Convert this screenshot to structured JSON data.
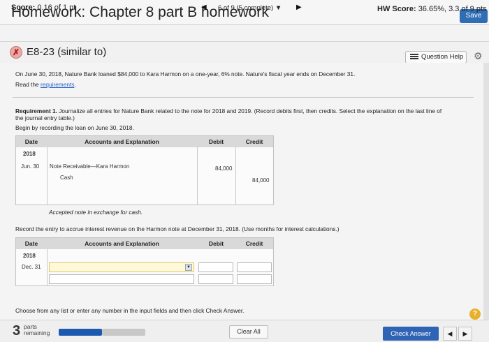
{
  "header": {
    "title": "Homework: Chapter 8 part B homework",
    "save_label": "Save"
  },
  "score": {
    "label": "Score:",
    "value": "0.16 of 1 pt",
    "progress": "6 of 9 (5 complete)",
    "hw_label": "HW Score:",
    "hw_value": "36.65%, 3.3 of 9 pts"
  },
  "question": {
    "title": "E8-23 (similar to)",
    "help_label": "Question Help",
    "intro": "On June 30, 2018, Nature Bank loaned $84,000 to Kara Harmon on a one-year, 6% note. Nature's fiscal year ends on December 31.",
    "read_prefix": "Read the ",
    "read_link": "requirements",
    "read_suffix": "."
  },
  "requirement": {
    "label": "Requirement 1.",
    "text": " Journalize all entries for Nature Bank related to the note for 2018 and 2019. (Record debits first, then credits. Select the explanation on the last line of",
    "text2": "the journal entry table.)",
    "begin": "Begin by recording the loan on June 30, 2018."
  },
  "table1": {
    "headers": [
      "Date",
      "Accounts and Explanation",
      "Debit",
      "Credit"
    ],
    "year": "2018",
    "date": "Jun. 30",
    "rows": [
      {
        "account": "Note Receivable—Kara Harmon",
        "debit": "84,000",
        "credit": ""
      },
      {
        "account": "Cash",
        "debit": "",
        "credit": "84,000"
      }
    ],
    "explanation": "Accepted note in exchange for cash."
  },
  "instruction2": "Record the entry to accrue interest revenue on the Harmon note at December 31, 2018. (Use months for interest calculations.)",
  "table2": {
    "headers": [
      "Date",
      "Accounts and Explanation",
      "Debit",
      "Credit"
    ],
    "year": "2018",
    "date": "Dec. 31"
  },
  "footer_hint": "Choose from any list or enter any number in the input fields and then click Check Answer.",
  "bottom": {
    "parts_count": "3",
    "parts_line1": "parts",
    "parts_line2": "remaining",
    "progress": 0.5,
    "clear_label": "Clear All",
    "check_label": "Check Answer"
  },
  "icons": {
    "nav_prev": "◀",
    "nav_next": "▶",
    "dropdown": "▼",
    "gear": "⚙",
    "help": "?",
    "question_status": "✗"
  }
}
